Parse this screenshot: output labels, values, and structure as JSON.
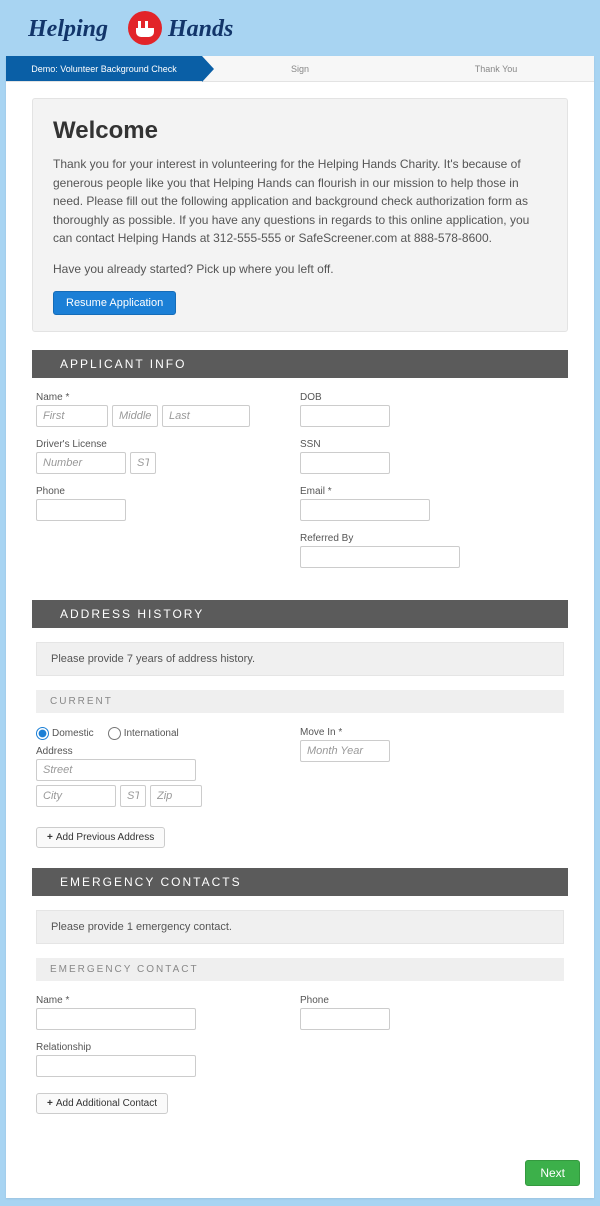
{
  "logo": {
    "word1": "Helping",
    "word2": "Hands"
  },
  "progress": {
    "steps": [
      {
        "label": "Demo: Volunteer Background Check",
        "active": true
      },
      {
        "label": "Sign",
        "active": false
      },
      {
        "label": "Thank You",
        "active": false
      }
    ]
  },
  "welcome": {
    "title": "Welcome",
    "body": "Thank you for your interest in volunteering for the Helping Hands Charity. It's because of generous people like you that Helping Hands can flourish in our mission to help those in need. Please fill out the following application and background check authorization form as thoroughly as possible. If you have any questions in regards to this online application, you can contact Helping Hands at 312-555-555 or SafeScreener.com at 888-578-8600.",
    "resume_prompt": "Have you already started? Pick up where you left off.",
    "resume_button": "Resume Application"
  },
  "sections": {
    "applicant": {
      "header": "APPLICANT INFO",
      "name_label": "Name *",
      "first_ph": "First",
      "middle_ph": "Middle",
      "last_ph": "Last",
      "dl_label": "Driver's License",
      "dl_num_ph": "Number",
      "dl_st_ph": "ST",
      "phone_label": "Phone",
      "dob_label": "DOB",
      "ssn_label": "SSN",
      "email_label": "Email *",
      "referred_label": "Referred By"
    },
    "address": {
      "header": "ADDRESS HISTORY",
      "note": "Please provide 7 years of address history.",
      "subheader": "CURRENT",
      "radio_domestic": "Domestic",
      "radio_intl": "International",
      "address_label": "Address",
      "street_ph": "Street",
      "city_ph": "City",
      "st_ph": "ST",
      "zip_ph": "Zip",
      "movein_label": "Move In *",
      "movein_ph": "Month Year",
      "add_prev": "Add Previous Address"
    },
    "emergency": {
      "header": "EMERGENCY CONTACTS",
      "note": "Please provide 1 emergency contact.",
      "subheader": "EMERGENCY CONTACT",
      "name_label": "Name *",
      "phone_label": "Phone",
      "rel_label": "Relationship",
      "add_contact": "Add Additional Contact"
    }
  },
  "footer": {
    "next": "Next"
  }
}
